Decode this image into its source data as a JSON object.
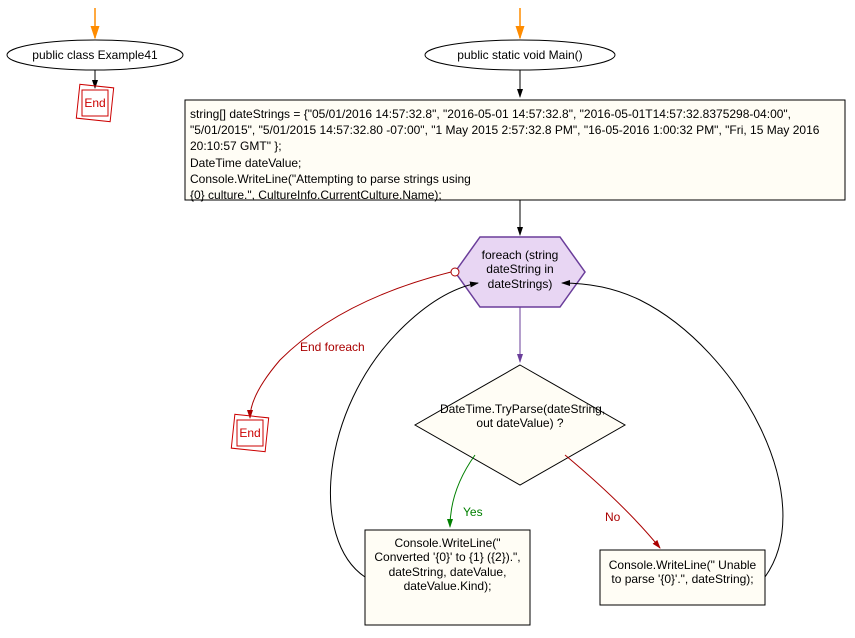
{
  "nodes": {
    "class_decl": "public class Example41",
    "end_left": "End",
    "main_decl": "public static void Main()",
    "code_block": "string[] dateStrings = {\"05/01/2016 14:57:32.8\", \"2016-05-01 14:57:32.8\", \"2016-05-01T14:57:32.8375298-04:00\", \"5/01/2015\", \"5/01/2015 14:57:32.80 -07:00\", \"1 May 2015 2:57:32.8 PM\", \"16-05-2016 1:00:32 PM\", \"Fri, 15 May 2016 20:10:57 GMT\" };\nDateTime dateValue;\nConsole.WriteLine(\"Attempting to parse strings using\n{0} culture.\", CultureInfo.CurrentCulture.Name);",
    "foreach": "foreach (string dateString in dateStrings)",
    "end_foreach_label": "End foreach",
    "end_middle": "End",
    "decision": "DateTime.TryParse(dateString, out dateValue) ?",
    "yes_label": "Yes",
    "no_label": "No",
    "yes_block": "Console.WriteLine(\" Converted '{0}' to {1} ({2}).\", dateString, dateValue, dateValue.Kind);",
    "no_block": "Console.WriteLine(\" Unable to parse '{0}'.\", dateString);"
  },
  "colors": {
    "arrow_orange": "#ff8c00",
    "arrow_black": "#000000",
    "arrow_red": "#aa0000",
    "arrow_green": "#008000",
    "ellipse_fill": "#ffffff",
    "ellipse_stroke": "#000000",
    "end_box_stroke": "#cc0000",
    "end_text": "#cc0000",
    "code_fill": "#fffdf5",
    "hex_fill": "#e8d6f3",
    "hex_stroke": "#6a3d9a",
    "diamond_fill": "#fffdf5",
    "diamond_stroke": "#000000",
    "green_text": "#008000",
    "red_text": "#aa0000",
    "purple_text": "#6a3d9a"
  }
}
